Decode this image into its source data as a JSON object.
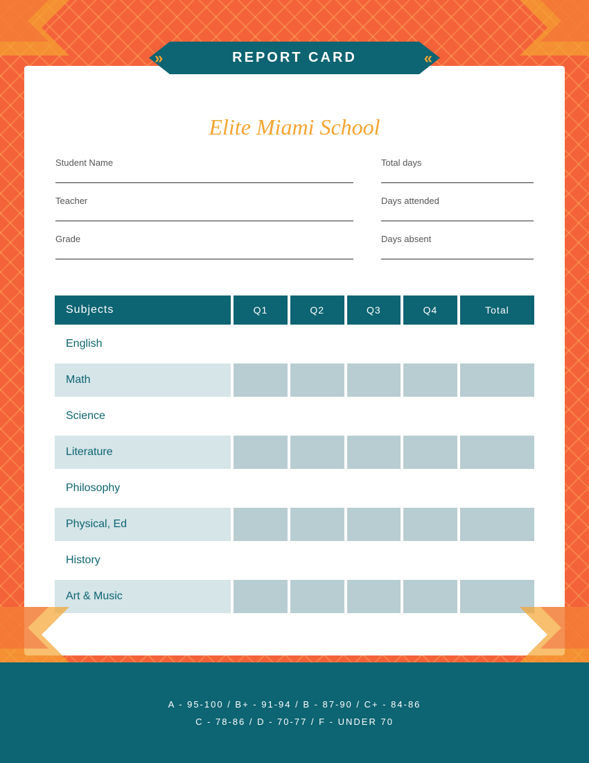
{
  "school": {
    "name": "Elite Miami School",
    "report_card_label": "REPORT CARD"
  },
  "info_fields": {
    "student_name_label": "Student Name",
    "teacher_label": "Teacher",
    "grade_label": "Grade",
    "total_days_label": "Total days",
    "days_attended_label": "Days attended",
    "days_absent_label": "Days absent"
  },
  "table": {
    "headers": [
      "Subjects",
      "Q1",
      "Q2",
      "Q3",
      "Q4",
      "Total"
    ],
    "rows": [
      {
        "subject": "English",
        "shaded": false
      },
      {
        "subject": "Math",
        "shaded": true
      },
      {
        "subject": "Science",
        "shaded": false
      },
      {
        "subject": "Literature",
        "shaded": true
      },
      {
        "subject": "Philosophy",
        "shaded": false
      },
      {
        "subject": "Physical, Ed",
        "shaded": true
      },
      {
        "subject": "History",
        "shaded": false
      },
      {
        "subject": "Art & Music",
        "shaded": true
      }
    ]
  },
  "grading_scale": {
    "line1": "A - 95-100 / B+ - 91-94 / B - 87-90 / C+ - 84-86",
    "line2": "C - 78-86 / D - 70-77 / F - UNDER 70"
  },
  "colors": {
    "teal": "#0d6472",
    "orange": "#f4a430",
    "salmon": "#f4623a",
    "light_blue": "#b8cdd1",
    "light_blue2": "#d5e5e8"
  }
}
